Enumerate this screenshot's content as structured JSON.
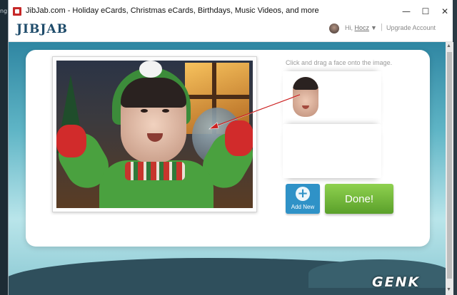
{
  "left_strip": {
    "text": "ng"
  },
  "window": {
    "title": "JibJab.com - Holiday eCards, Christmas eCards, Birthdays, Music Videos, and more",
    "controls": {
      "minimize": "—",
      "maximize": "☐",
      "close": "✕"
    }
  },
  "header": {
    "logo": "JIBJAB",
    "greeting": "Hi,",
    "username": "Hocz",
    "dropdown": "▼",
    "separator": "|",
    "upgrade_label": "Upgrade Account"
  },
  "editor": {
    "instruction": "Click and drag a face onto the image.",
    "add_new_label": "Add New",
    "add_new_icon": "+",
    "done_label": "Done!"
  },
  "colors": {
    "done_green": "#6fb53a",
    "add_new_blue": "#2f92c7",
    "drag_arrow": "#cc2222",
    "logo_blue": "#1f4c6b"
  },
  "watermark": "GENK"
}
